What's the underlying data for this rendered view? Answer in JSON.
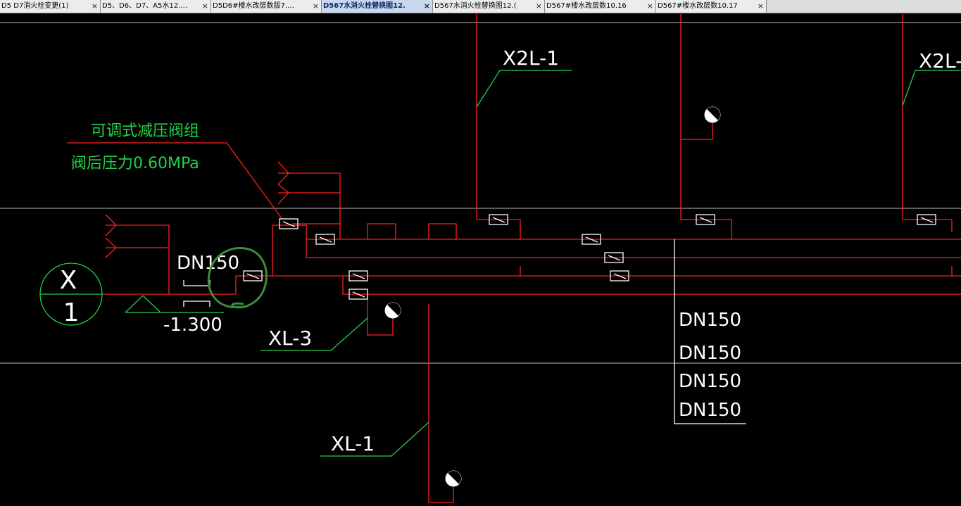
{
  "tabs": [
    {
      "label": "D5 D7消火栓变更(1)",
      "active": false
    },
    {
      "label": "D5、D6、D7、A5水12.…",
      "active": false
    },
    {
      "label": "D5D6#楼水改层数版7.…",
      "active": false
    },
    {
      "label": "D567水消火栓替换图12.",
      "active": true
    },
    {
      "label": "D567水消火栓替换图12.(",
      "active": false
    },
    {
      "label": "D567#楼水改层数10.16",
      "active": false
    },
    {
      "label": "D567#楼水改层数10.17",
      "active": false
    }
  ],
  "tab_close_glyph": "×",
  "drawing": {
    "colors": {
      "pipe": "#ff1e1e",
      "annotation": "#22d04a",
      "white": "#ffffff",
      "grid": "#bdbdbd",
      "markup": "#3c8c3c"
    },
    "notes": {
      "valve_group_line1": "可调式减压阀组",
      "valve_group_line2": "阀后压力0.60MPa"
    },
    "axis_bubble": {
      "top": "X",
      "bottom": "1"
    },
    "labels": {
      "dn_left": "DN150",
      "elevation": "-1.300",
      "xl3": "XL-3",
      "xl1": "XL-1",
      "x2l1": "X2L-1",
      "x2l_edge": "X2L-",
      "dn_stack": [
        "DN150",
        "DN150",
        "DN150",
        "DN150"
      ]
    }
  }
}
